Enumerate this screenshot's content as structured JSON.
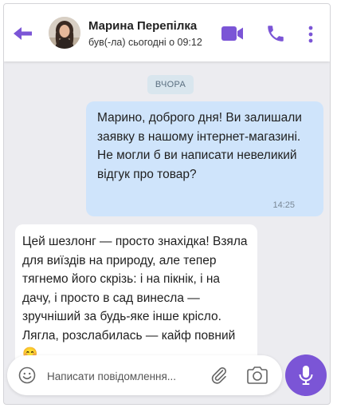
{
  "header": {
    "contact_name": "Марина Перепілка",
    "status": "був(-ла) сьогодні о 09:12"
  },
  "chat": {
    "date_divider": "ВЧОРА",
    "messages": [
      {
        "direction": "outgoing",
        "text": "Марино, доброго дня! Ви залишали заявку в нашому інтернет-магазині. Не могли б ви написати невеликий відгук про товар?",
        "time": "14:25"
      },
      {
        "direction": "incoming",
        "text": "Цей шезлонг — просто знахідка! Взяла для виїздів на природу, але тепер тягнемо його скрізь: і на пікнік, і на дачу, і просто в сад винесла — зручніший за будь-яке інше крісло. Лягла, розслабилась — кайф повний 😊"
      }
    ]
  },
  "composer": {
    "placeholder": "Написати повідомлення...",
    "value": ""
  },
  "icons": {
    "back": "back-arrow-icon",
    "video": "video-camera-icon",
    "call": "phone-icon",
    "more": "more-vertical-icon",
    "emoji": "emoji-icon",
    "attach": "paperclip-icon",
    "camera": "camera-icon",
    "mic": "microphone-icon"
  },
  "colors": {
    "accent": "#7b55d6",
    "outgoing_bubble": "#cfe4fb",
    "incoming_bubble": "#ffffff",
    "chat_background": "#ececf0",
    "date_pill": "#d9e6ee"
  }
}
